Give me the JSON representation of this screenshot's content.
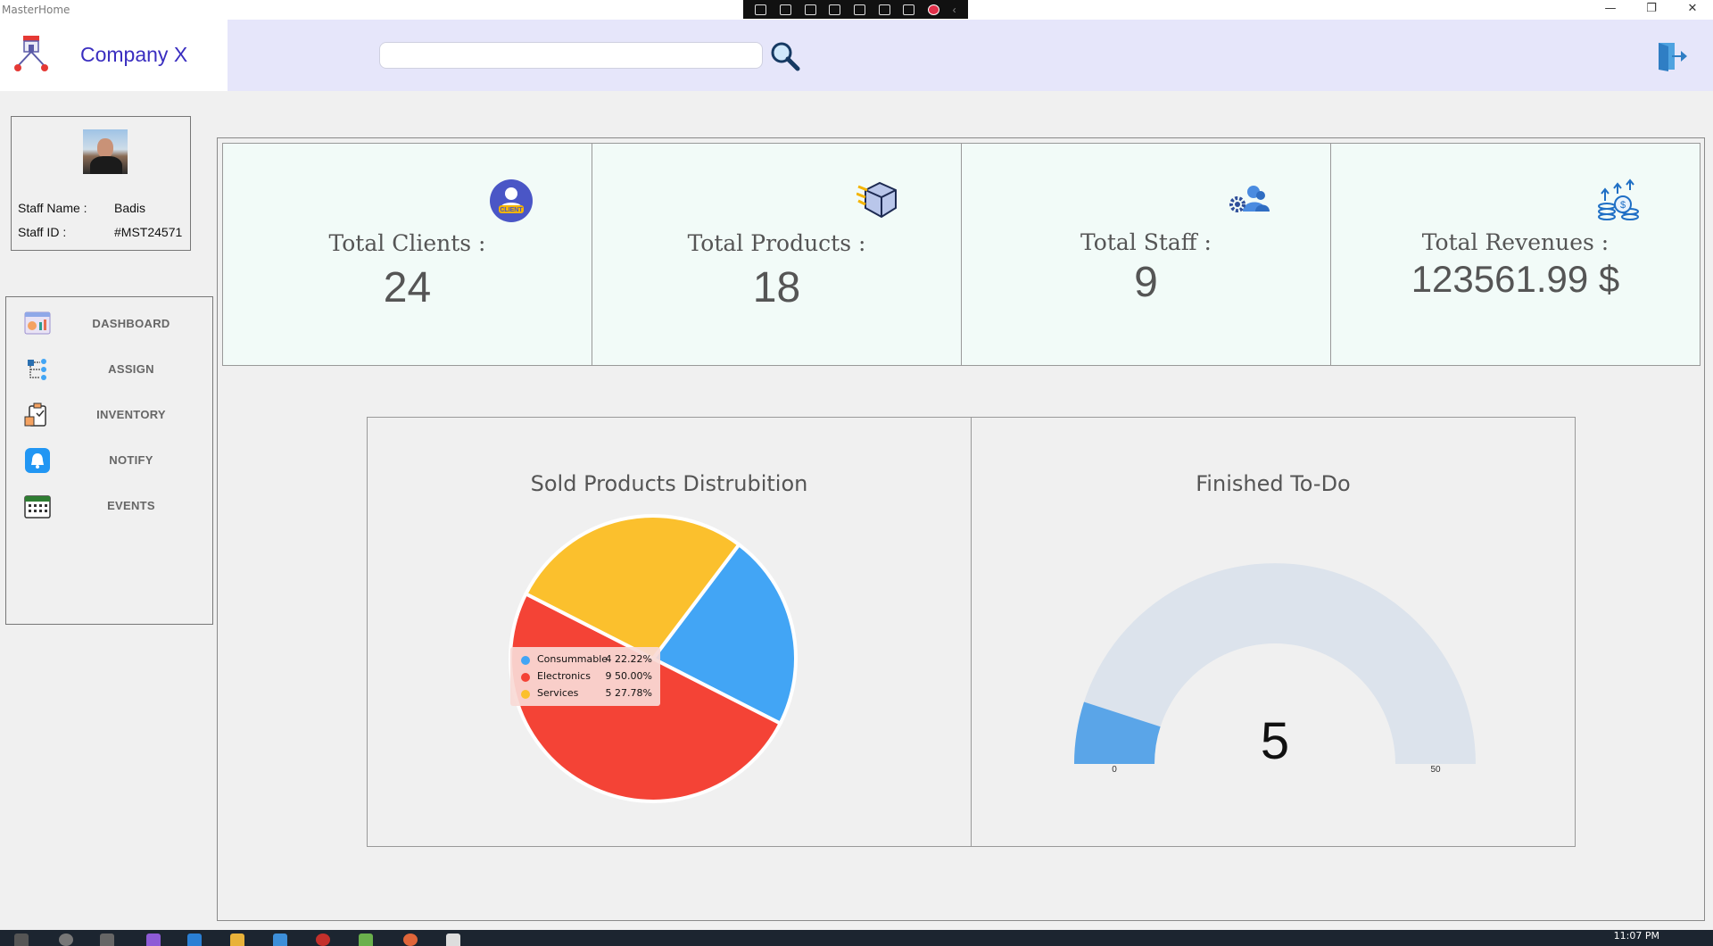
{
  "window": {
    "title": "MasterHome",
    "minimize": "—",
    "restore": "❐",
    "close": "✕"
  },
  "brand": {
    "company": "Company X"
  },
  "header": {
    "search_placeholder": "",
    "search_icon": "search-icon",
    "logout_icon": "logout-icon"
  },
  "profile": {
    "name_label": "Staff  Name :",
    "name_value": "Badis",
    "id_label": "Staff ID :",
    "id_value": "#MST24571"
  },
  "nav": {
    "items": [
      {
        "label": "DASHBOARD",
        "icon": "dashboard-icon"
      },
      {
        "label": "ASSIGN",
        "icon": "assign-icon"
      },
      {
        "label": "INVENTORY",
        "icon": "inventory-icon"
      },
      {
        "label": "NOTIFY",
        "icon": "bell-icon"
      },
      {
        "label": "EVENTS",
        "icon": "calendar-icon"
      }
    ]
  },
  "cards": [
    {
      "title": "Total Clients :",
      "value": "24",
      "icon": "client-icon"
    },
    {
      "title": "Total Products :",
      "value": "18",
      "icon": "box-icon"
    },
    {
      "title": "Total Staff :",
      "value": "9",
      "icon": "staff-icon"
    },
    {
      "title": "Total Revenues :",
      "value": "123561.99 $",
      "icon": "revenue-icon"
    }
  ],
  "charts": {
    "pie_title": "Sold Products Distrubition",
    "gauge_title": "Finished To-Do",
    "legend": [
      {
        "name": "Consummable",
        "value": "4 22.22%",
        "color": "#42a5f5"
      },
      {
        "name": "Electronics",
        "value": "9 50.00%",
        "color": "#f44336"
      },
      {
        "name": "Services",
        "value": "5 27.78%",
        "color": "#fbc02d"
      }
    ]
  },
  "chart_data": [
    {
      "type": "pie",
      "title": "Sold Products Distrubition",
      "categories": [
        "Consummable",
        "Electronics",
        "Services"
      ],
      "values": [
        4,
        9,
        5
      ],
      "percents": [
        22.22,
        50.0,
        27.78
      ],
      "colors": [
        "#42a5f5",
        "#f44336",
        "#fbc02d"
      ]
    },
    {
      "type": "gauge",
      "title": "Finished To-Do",
      "value": 5,
      "min": 0,
      "max": 50,
      "min_label": "0",
      "max_label": "50",
      "fill_color": "#5aa5e8",
      "track_color": "#dce3ec"
    }
  ],
  "taskbar": {
    "clock": "11:07 PM"
  }
}
